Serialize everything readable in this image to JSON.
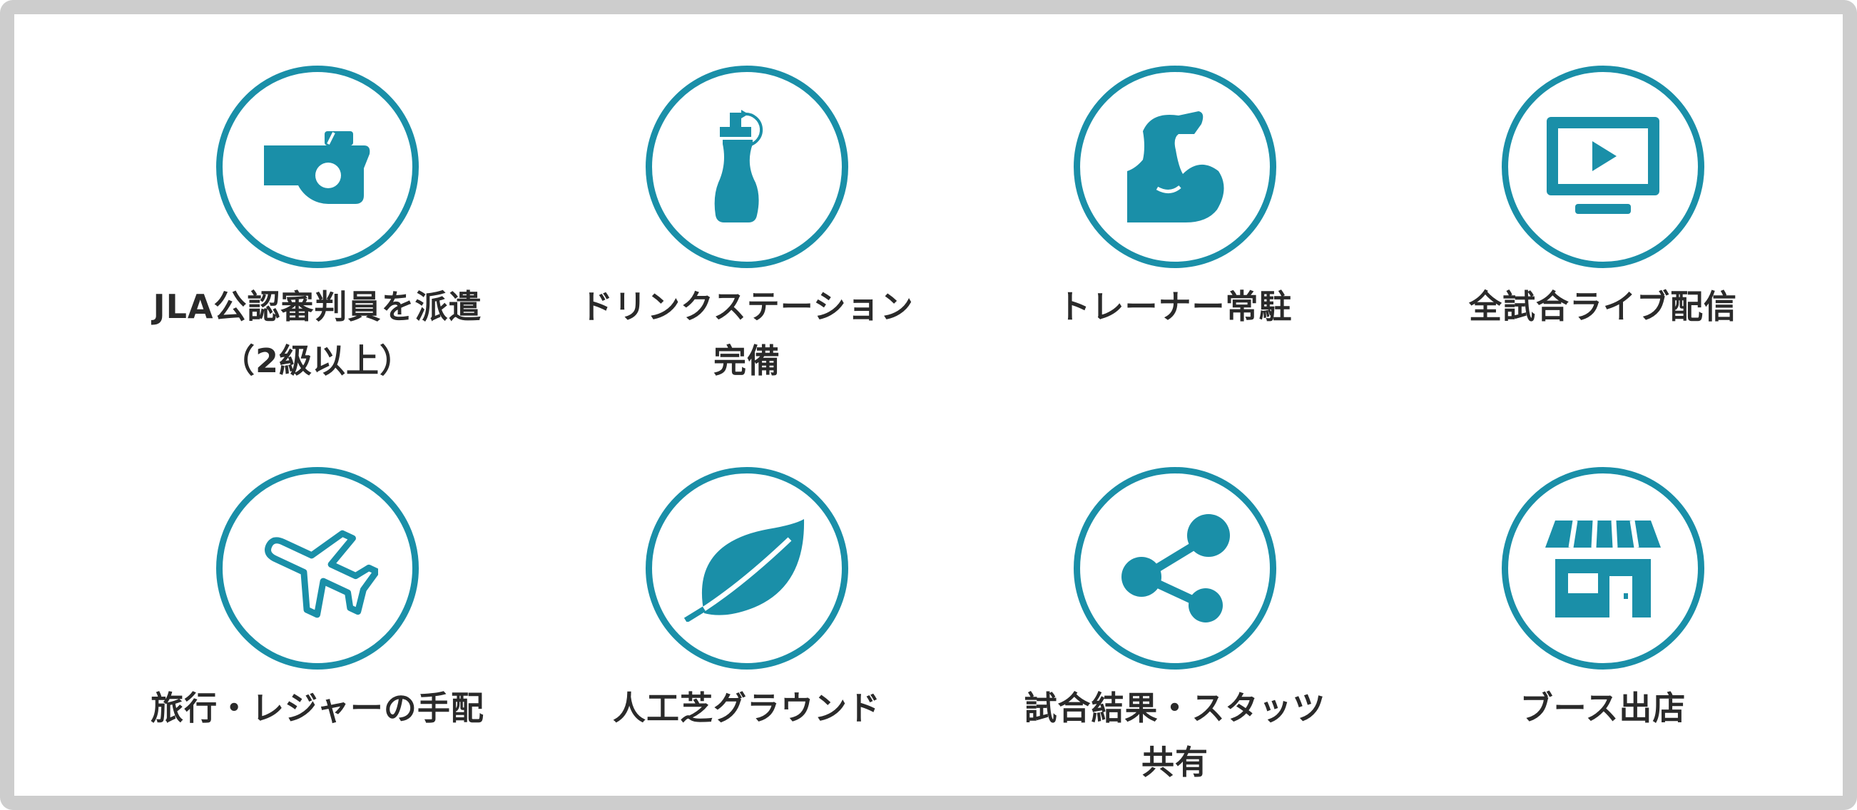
{
  "accent_color": "#1a8fa8",
  "features": [
    {
      "icon": "whistle-icon",
      "line1": "JLA公認審判員を派遣",
      "line2": "（2級以上）"
    },
    {
      "icon": "drink-bottle-icon",
      "line1": "ドリンクステーション",
      "line2": "完備"
    },
    {
      "icon": "flexed-arm-icon",
      "line1": "トレーナー常駐",
      "line2": ""
    },
    {
      "icon": "monitor-play-icon",
      "line1": "全試合ライブ配信",
      "line2": ""
    },
    {
      "icon": "airplane-icon",
      "line1": "旅行・レジャーの手配",
      "line2": ""
    },
    {
      "icon": "leaf-icon",
      "line1": "人工芝グラウンド",
      "line2": ""
    },
    {
      "icon": "share-icon",
      "line1": "試合結果・スタッツ",
      "line2": "共有"
    },
    {
      "icon": "storefront-icon",
      "line1": "ブース出店",
      "line2": ""
    }
  ]
}
